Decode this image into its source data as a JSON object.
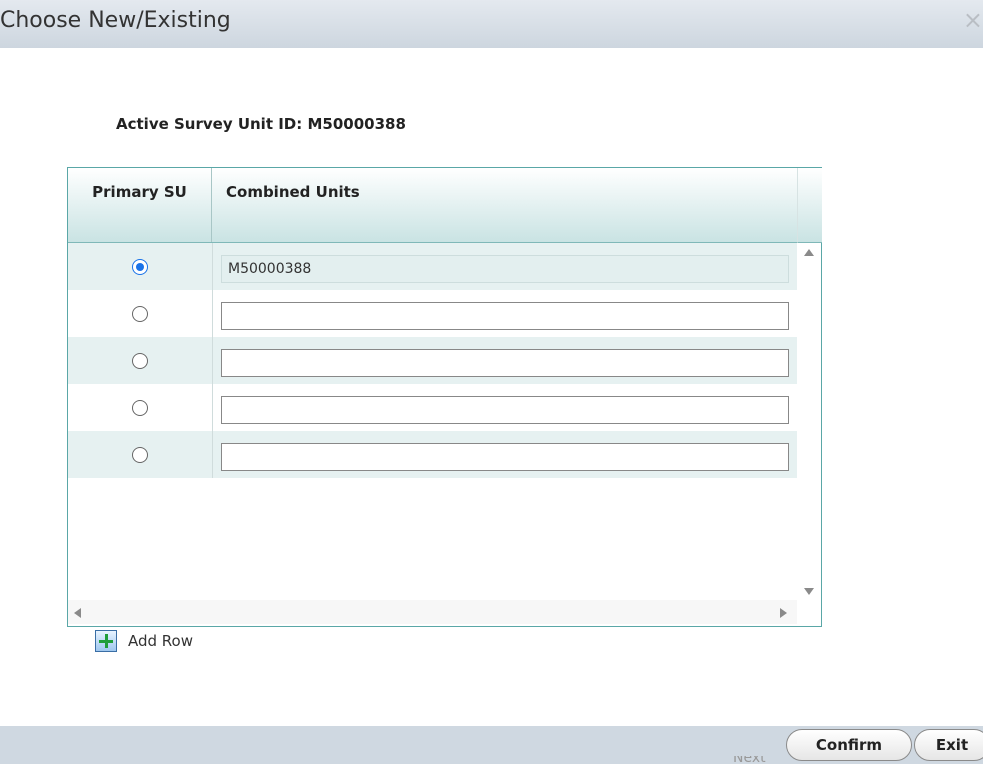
{
  "dialog": {
    "title": "Choose New/Existing",
    "close_glyph": "×"
  },
  "active_survey_unit": "Active Survey Unit ID: M50000388",
  "table": {
    "columns": [
      "Primary SU",
      "Combined Units"
    ],
    "rows": [
      {
        "primary_selected": true,
        "value": "M50000388",
        "readonly": true
      },
      {
        "primary_selected": false,
        "value": "",
        "readonly": false
      },
      {
        "primary_selected": false,
        "value": "",
        "readonly": false
      },
      {
        "primary_selected": false,
        "value": "",
        "readonly": false
      },
      {
        "primary_selected": false,
        "value": "",
        "readonly": false
      }
    ]
  },
  "add_row": {
    "label": "Add Row",
    "icon": "add-row-icon"
  },
  "footer": {
    "confirm_label": "Confirm",
    "exit_label": "Exit",
    "partial_text": "Next"
  },
  "colors": {
    "titlebar": "#cdd6df",
    "grid_border": "#5aa7a7",
    "row_alt": "#e6f1f1",
    "radio_selected": "#1a73e8"
  }
}
